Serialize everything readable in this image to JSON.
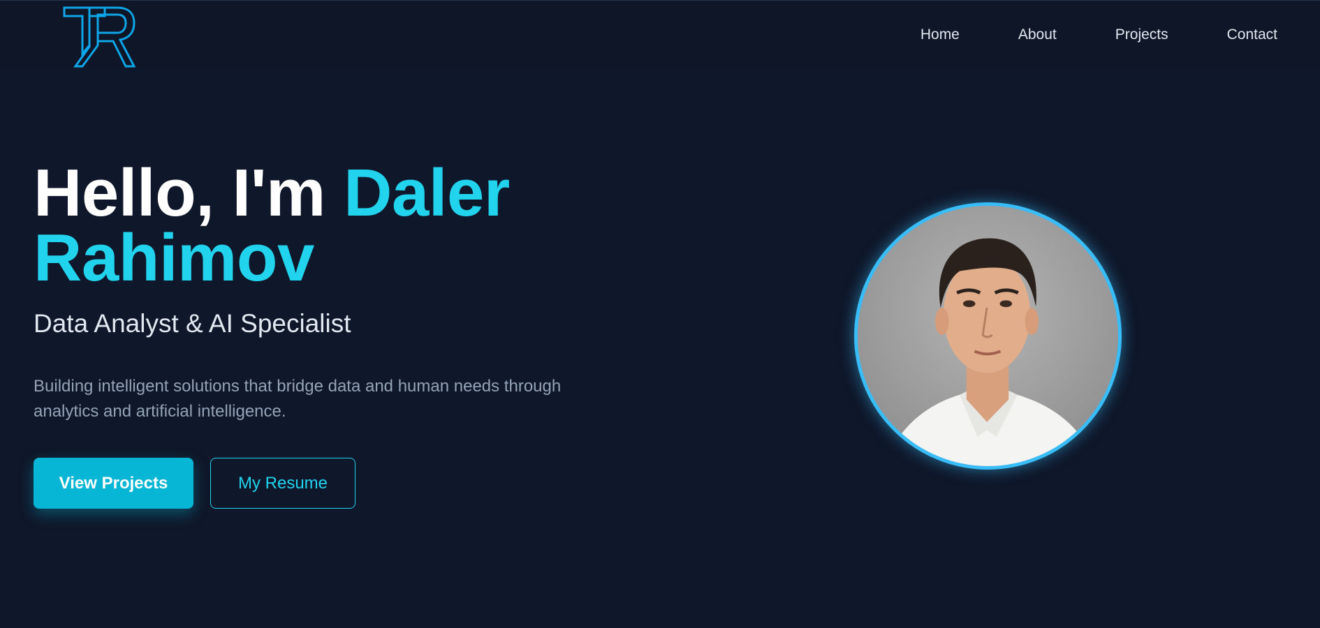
{
  "header": {
    "logo": {
      "icon": "tr-logo-icon"
    },
    "nav": [
      {
        "label": "Home"
      },
      {
        "label": "About"
      },
      {
        "label": "Projects"
      },
      {
        "label": "Contact"
      }
    ]
  },
  "hero": {
    "greeting": "Hello, I'm ",
    "name_first": "Daler",
    "name_last": "Rahimov",
    "subtitle": "Data Analyst & AI Specialist",
    "description": "Building intelligent solutions that bridge data and human needs through analytics and artificial intelligence.",
    "primary_button": "View Projects",
    "secondary_button": "My Resume",
    "avatar": {
      "icon": "profile-photo"
    }
  },
  "colors": {
    "background": "#0f172a",
    "accent": "#22d3ee",
    "primary_button": "#06b6d4",
    "avatar_ring": "#38bdf8"
  }
}
